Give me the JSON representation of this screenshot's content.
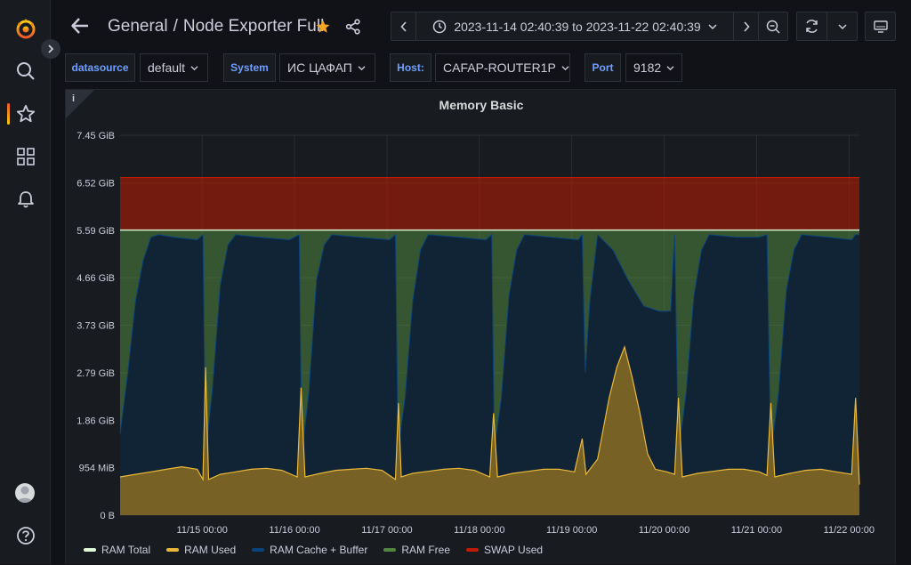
{
  "sidebar": {
    "items": [
      {
        "name": "grafana-logo-icon"
      },
      {
        "name": "search-icon"
      },
      {
        "name": "starred-icon"
      },
      {
        "name": "dashboards-icon"
      },
      {
        "name": "alerting-icon"
      }
    ],
    "bottom": [
      {
        "name": "profile-avatar"
      },
      {
        "name": "help-icon"
      }
    ]
  },
  "header": {
    "folder": "General",
    "separator": "/",
    "dashboard_title": "Node Exporter Full",
    "time_range": "2023-11-14 02:40:39 to 2023-11-22 02:40:39",
    "colors": {
      "star": "#f5a623",
      "accent": "#6e9fff"
    }
  },
  "variables": [
    {
      "label": "datasource",
      "value": "default"
    },
    {
      "label": "System",
      "value": "ИС ЦАФАП"
    },
    {
      "label": "Host:",
      "value": "CAFAP-ROUTER1P"
    },
    {
      "label": "Port",
      "value": "9182"
    }
  ],
  "panel": {
    "info_glyph": "i",
    "title": "Memory Basic"
  },
  "chart_data": {
    "type": "area",
    "title": "Memory Basic",
    "y_ticks": [
      "0 B",
      "954 MiB",
      "1.86 GiB",
      "2.79 GiB",
      "3.73 GiB",
      "4.66 GiB",
      "5.59 GiB",
      "6.52 GiB",
      "7.45 GiB"
    ],
    "ylim_gib": [
      0,
      7.45
    ],
    "x_ticks": [
      "11/15 00:00",
      "11/16 00:00",
      "11/17 00:00",
      "11/18 00:00",
      "11/19 00:00",
      "11/20 00:00",
      "11/21 00:00",
      "11/22 00:00"
    ],
    "x_range_hours": [
      0,
      192
    ],
    "first_tick_hour": 21.3,
    "grid": true,
    "legend_position": "bottom-left",
    "ram_total_gib": 5.59,
    "swap_top_gib": 6.62,
    "series": [
      {
        "name": "RAM Used",
        "color": "#eab839",
        "points": [
          [
            0,
            0.75
          ],
          [
            4,
            0.8
          ],
          [
            8,
            0.85
          ],
          [
            12,
            0.9
          ],
          [
            16,
            0.95
          ],
          [
            20,
            0.9
          ],
          [
            21.5,
            0.7
          ],
          [
            22.2,
            2.9
          ],
          [
            23,
            0.7
          ],
          [
            26,
            0.8
          ],
          [
            30,
            0.85
          ],
          [
            34,
            0.9
          ],
          [
            38,
            0.92
          ],
          [
            42,
            0.88
          ],
          [
            46,
            0.75
          ],
          [
            47,
            2.5
          ],
          [
            48,
            0.75
          ],
          [
            52,
            0.82
          ],
          [
            56,
            0.88
          ],
          [
            60,
            0.9
          ],
          [
            64,
            0.92
          ],
          [
            68,
            0.88
          ],
          [
            71.5,
            0.7
          ],
          [
            72.3,
            2.2
          ],
          [
            73,
            0.75
          ],
          [
            76,
            0.82
          ],
          [
            80,
            0.86
          ],
          [
            84,
            0.9
          ],
          [
            88,
            0.92
          ],
          [
            92,
            0.88
          ],
          [
            96,
            0.75
          ],
          [
            97,
            2.0
          ],
          [
            98,
            0.75
          ],
          [
            102,
            0.82
          ],
          [
            106,
            0.86
          ],
          [
            110,
            0.9
          ],
          [
            114,
            0.9
          ],
          [
            118,
            0.85
          ],
          [
            120,
            1.5
          ],
          [
            121,
            0.8
          ],
          [
            124,
            1.1
          ],
          [
            127,
            2.3
          ],
          [
            129,
            2.9
          ],
          [
            131,
            3.3
          ],
          [
            133,
            2.7
          ],
          [
            135,
            2.0
          ],
          [
            137,
            1.2
          ],
          [
            139,
            0.9
          ],
          [
            142,
            0.85
          ],
          [
            144,
            0.8
          ],
          [
            145,
            2.3
          ],
          [
            146,
            0.75
          ],
          [
            150,
            0.82
          ],
          [
            154,
            0.86
          ],
          [
            158,
            0.9
          ],
          [
            162,
            0.9
          ],
          [
            166,
            0.85
          ],
          [
            168,
            0.78
          ],
          [
            169,
            2.2
          ],
          [
            170,
            0.75
          ],
          [
            174,
            0.82
          ],
          [
            178,
            0.88
          ],
          [
            182,
            0.9
          ],
          [
            186,
            0.85
          ],
          [
            190,
            0.8
          ],
          [
            191,
            2.3
          ],
          [
            192,
            0.6
          ]
        ]
      },
      {
        "name": "RAM Cache + Buffer",
        "color": "#0a437c",
        "points": [
          [
            0,
            1.6
          ],
          [
            2,
            2.8
          ],
          [
            4,
            4.2
          ],
          [
            6,
            5.0
          ],
          [
            8,
            5.45
          ],
          [
            10,
            5.5
          ],
          [
            14,
            5.45
          ],
          [
            20,
            5.4
          ],
          [
            21.5,
            5.5
          ],
          [
            22.2,
            1.2
          ],
          [
            24,
            2.5
          ],
          [
            26,
            4.5
          ],
          [
            28,
            5.3
          ],
          [
            30,
            5.5
          ],
          [
            36,
            5.45
          ],
          [
            44,
            5.4
          ],
          [
            46.5,
            5.5
          ],
          [
            47.2,
            1.2
          ],
          [
            49,
            2.4
          ],
          [
            51,
            4.6
          ],
          [
            53,
            5.3
          ],
          [
            55,
            5.5
          ],
          [
            62,
            5.45
          ],
          [
            70,
            5.4
          ],
          [
            71.5,
            5.5
          ],
          [
            72.2,
            1.3
          ],
          [
            74,
            2.3
          ],
          [
            76,
            4.2
          ],
          [
            78,
            5.2
          ],
          [
            80,
            5.5
          ],
          [
            88,
            5.45
          ],
          [
            95,
            5.4
          ],
          [
            96.5,
            5.5
          ],
          [
            97.2,
            1.3
          ],
          [
            99,
            2.3
          ],
          [
            101,
            4.3
          ],
          [
            103,
            5.2
          ],
          [
            105,
            5.5
          ],
          [
            112,
            5.45
          ],
          [
            119,
            5.4
          ],
          [
            120,
            5.5
          ],
          [
            120.8,
            2.8
          ],
          [
            122,
            4.2
          ],
          [
            124,
            5.5
          ],
          [
            128,
            5.2
          ],
          [
            132,
            4.6
          ],
          [
            136,
            4.1
          ],
          [
            140,
            4.0
          ],
          [
            143,
            4.0
          ],
          [
            144,
            5.5
          ],
          [
            145,
            1.2
          ],
          [
            147,
            2.4
          ],
          [
            149,
            4.3
          ],
          [
            151,
            5.2
          ],
          [
            153,
            5.5
          ],
          [
            160,
            5.45
          ],
          [
            166,
            5.45
          ],
          [
            168,
            5.5
          ],
          [
            169,
            1.2
          ],
          [
            171,
            2.4
          ],
          [
            173,
            4.4
          ],
          [
            175,
            5.2
          ],
          [
            177,
            5.5
          ],
          [
            184,
            5.45
          ],
          [
            190,
            5.4
          ],
          [
            191,
            5.5
          ],
          [
            192,
            5.5
          ]
        ]
      },
      {
        "name": "RAM Free",
        "color": "#508642"
      },
      {
        "name": "SWAP Used",
        "color": "#bf1b00"
      },
      {
        "name": "RAM Total",
        "color": "#e0f9d7"
      }
    ]
  },
  "legend": [
    {
      "label": "RAM Total",
      "color": "#e0f9d7"
    },
    {
      "label": "RAM Used",
      "color": "#eab839"
    },
    {
      "label": "RAM Cache + Buffer",
      "color": "#0a437c"
    },
    {
      "label": "RAM Free",
      "color": "#508642"
    },
    {
      "label": "SWAP Used",
      "color": "#bf1b00"
    }
  ]
}
